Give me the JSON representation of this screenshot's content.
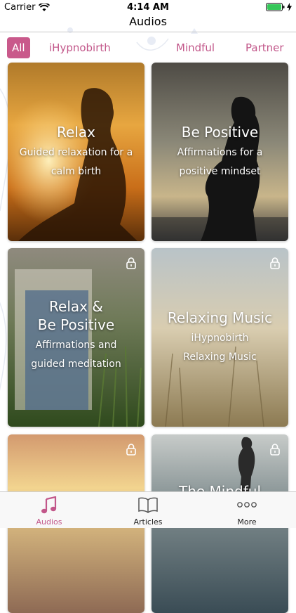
{
  "status_bar": {
    "carrier": "Carrier",
    "time": "4:14 AM"
  },
  "nav": {
    "title": "Audios"
  },
  "filters": [
    {
      "label": "All",
      "selected": true
    },
    {
      "label": "iHypnobirth",
      "selected": false
    },
    {
      "label": "Mindful",
      "selected": false
    },
    {
      "label": "Partner",
      "selected": false
    }
  ],
  "cards": [
    {
      "title": "Relax",
      "subtitle_lines": [
        "Guided relaxation for a",
        "calm birth"
      ],
      "locked": false
    },
    {
      "title": "Be Positive",
      "subtitle_lines": [
        "Affirmations for a",
        "positive mindset"
      ],
      "locked": false
    },
    {
      "title_lines": [
        "Relax &",
        "Be Positive"
      ],
      "subtitle_lines": [
        "Affirmations and",
        "guided meditation"
      ],
      "locked": true
    },
    {
      "title": "Relaxing Music",
      "subtitle_lines": [
        "iHypnobirth",
        "Relaxing Music"
      ],
      "locked": true
    },
    {
      "title": "",
      "locked": true
    },
    {
      "title": "The Mindful",
      "locked": true
    }
  ],
  "tab_bar": [
    {
      "label": "Audios",
      "icon": "music-note-icon",
      "selected": true
    },
    {
      "label": "Articles",
      "icon": "open-book-icon",
      "selected": false
    },
    {
      "label": "More",
      "icon": "ellipsis-icon",
      "selected": false
    }
  ],
  "colors": {
    "accent": "#c9598b",
    "tab_active": "#c2578a"
  }
}
